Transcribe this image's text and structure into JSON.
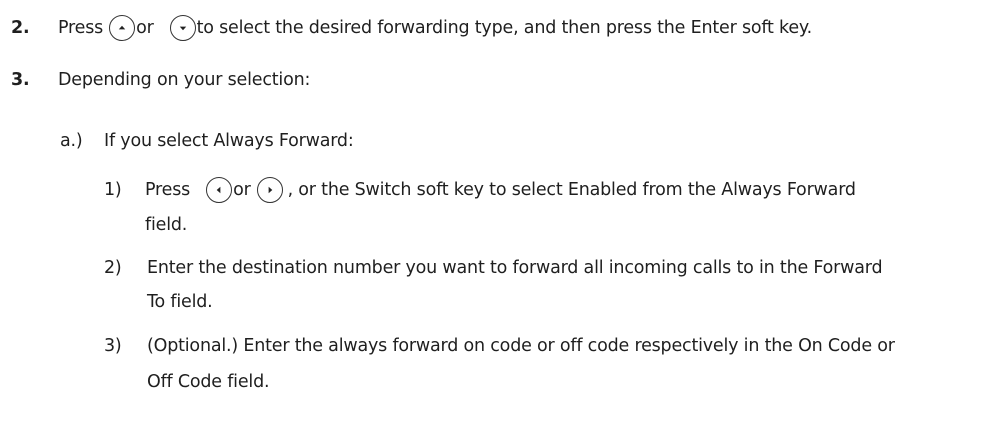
{
  "steps": [
    {
      "number": "2.",
      "text_before": "Press",
      "text_or": "or",
      "text_after": "to select the desired forwarding type, and then press the Enter soft key."
    },
    {
      "number": "3.",
      "text": "Depending on your selection:"
    }
  ],
  "substep_a": {
    "label": "a.)",
    "text": "If you select Always Forward:",
    "items": [
      {
        "number": "1)",
        "text_before": "Press",
        "text_or": "or",
        "text_after": ", or the Switch soft key to select Enabled from the Always Forward",
        "text_cont": "field."
      },
      {
        "number": "2)",
        "text": "Enter the destination number you want to forward all incoming calls to in the Forward",
        "text_cont": "To field."
      },
      {
        "number": "3)",
        "text": "(Optional.) Enter the always forward on code or off code respectively in the On Code or",
        "text_cont": "Off Code field."
      }
    ]
  },
  "icons": [
    "up-arrow-key",
    "down-arrow-key",
    "left-arrow-key",
    "right-arrow-key"
  ]
}
